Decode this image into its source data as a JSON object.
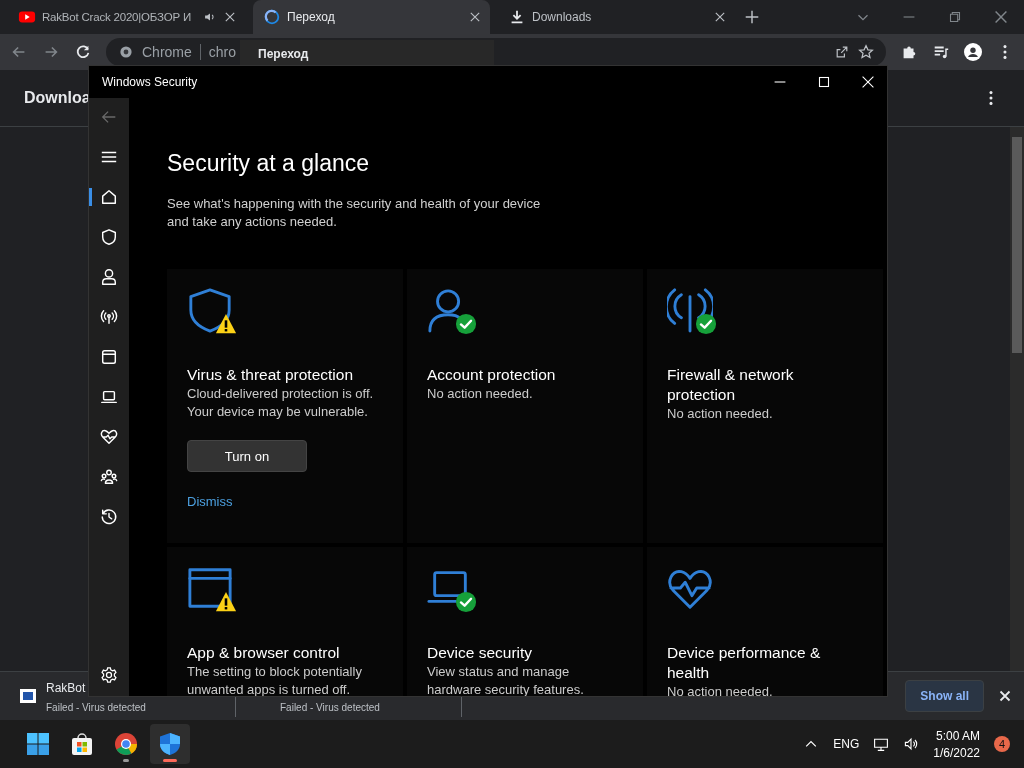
{
  "browser": {
    "tabs": [
      {
        "title": "RakBot Crack 2020|ОБЗОР И",
        "kind": "video",
        "audio": true,
        "selected": false
      },
      {
        "title": "Переход",
        "kind": "loading",
        "audio": false,
        "selected": true
      },
      {
        "title": "Downloads",
        "kind": "download",
        "audio": false,
        "selected": false
      }
    ],
    "address": {
      "chip": "Chrome",
      "url": "chro"
    },
    "tooltip": "Переход",
    "page_title": "Downloa",
    "download_shelf": {
      "items": [
        {
          "name": "RakBot",
          "status": "Failed - Virus detected"
        },
        {
          "status": "Failed - Virus detected"
        }
      ],
      "show_all": "Show all"
    }
  },
  "security_window": {
    "title": "Windows Security",
    "nav": [
      {
        "kind": "home",
        "selected": true
      },
      {
        "kind": "shield",
        "selected": false
      },
      {
        "kind": "person",
        "selected": false
      },
      {
        "kind": "antenna",
        "selected": false
      },
      {
        "kind": "window",
        "selected": false
      },
      {
        "kind": "laptop",
        "selected": false
      },
      {
        "kind": "heart",
        "selected": false
      },
      {
        "kind": "family",
        "selected": false
      },
      {
        "kind": "history",
        "selected": false
      }
    ],
    "heading": "Security at a glance",
    "intro": "See what's happening with the security and health of your device and take any actions needed.",
    "cards": [
      {
        "kind": "shield",
        "warning": true,
        "ok": false,
        "title": "Virus & threat protection",
        "description": "Cloud-delivered protection is off. Your device may be vulnerable.",
        "button": "Turn on",
        "link": "Dismiss"
      },
      {
        "kind": "person",
        "warning": false,
        "ok": true,
        "title": "Account protection",
        "description": "No action needed."
      },
      {
        "kind": "antenna",
        "warning": false,
        "ok": true,
        "title": "Firewall & network protection",
        "description": "No action needed."
      },
      {
        "kind": "window",
        "warning": true,
        "ok": false,
        "title": "App & browser control",
        "description": "The setting to block potentially unwanted apps is turned off."
      },
      {
        "kind": "laptop",
        "warning": false,
        "ok": true,
        "title": "Device security",
        "description": "View status and manage hardware security features."
      },
      {
        "kind": "heart",
        "warning": false,
        "ok": false,
        "title": "Device performance & health",
        "description": "No action needed."
      }
    ]
  },
  "taskbar": {
    "apps": [
      {
        "kind": "start",
        "running": false,
        "selected": false
      },
      {
        "kind": "store",
        "running": false,
        "selected": false
      },
      {
        "kind": "chrome",
        "running": true,
        "selected": false
      },
      {
        "kind": "defender",
        "running": true,
        "selected": true
      }
    ],
    "language": "ENG",
    "time": "5:00 AM",
    "date": "1/6/2022",
    "notifications": "4"
  }
}
